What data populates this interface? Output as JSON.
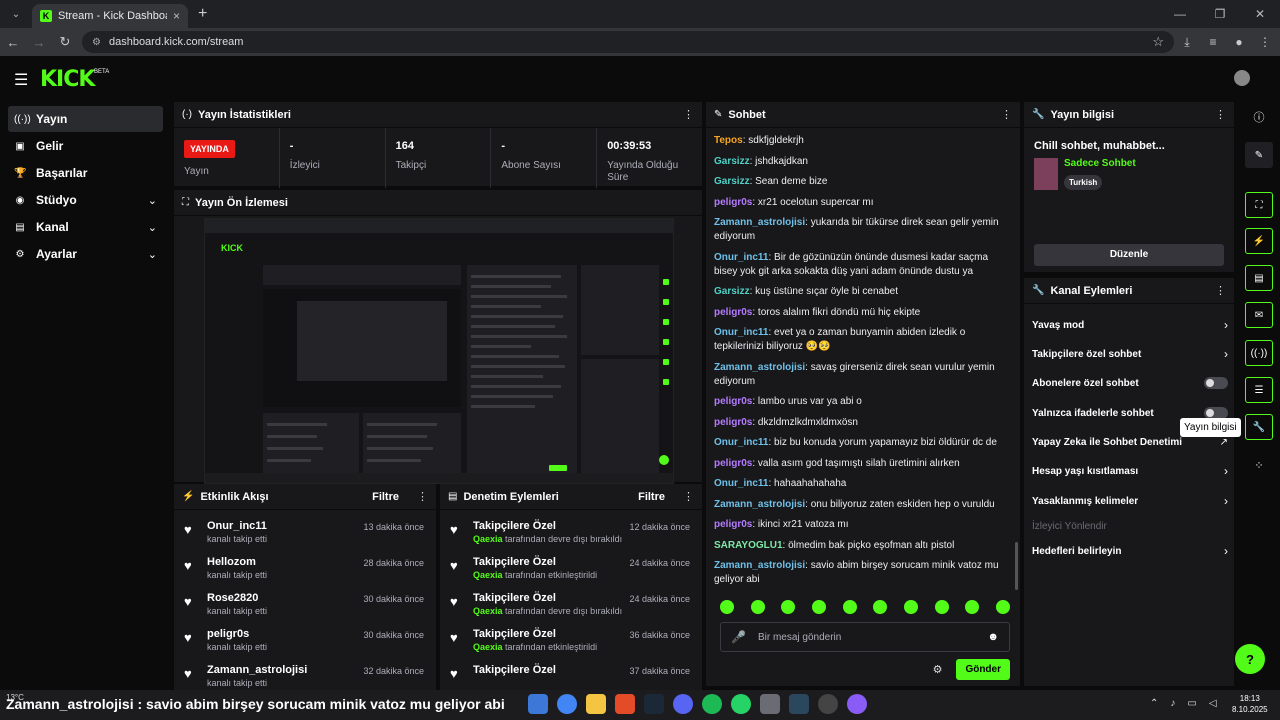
{
  "browser": {
    "tab_title": "Stream - Kick Dashboard",
    "url": "dashboard.kick.com/stream"
  },
  "brand": {
    "logo": "KICK",
    "beta": "BETA"
  },
  "sidebar": {
    "items": [
      {
        "label": "Yayın",
        "icon": "broadcast-icon"
      },
      {
        "label": "Gelir",
        "icon": "dollar-icon"
      },
      {
        "label": "Başarılar",
        "icon": "trophy-icon"
      },
      {
        "label": "Stüdyo",
        "icon": "studio-icon"
      },
      {
        "label": "Kanal",
        "icon": "channel-icon"
      },
      {
        "label": "Ayarlar",
        "icon": "gear-icon"
      }
    ]
  },
  "stats": {
    "title": "Yayın İstatistikleri",
    "live_badge": "YAYINDA",
    "live_label": "Yayın",
    "viewers_value": "-",
    "viewers_label": "İzleyici",
    "followers_value": "164",
    "followers_label": "Takipçi",
    "subs_value": "-",
    "subs_label": "Abone Sayısı",
    "uptime_value": "00:39:53",
    "uptime_label": "Yayında Olduğu Süre"
  },
  "preview": {
    "title": "Yayın Ön İzlemesi"
  },
  "activity": {
    "title": "Etkinlik Akışı",
    "filter": "Filtre",
    "items": [
      {
        "name": "Onur_inc11",
        "sub": "kanalı takip etti",
        "time": "13 dakika önce"
      },
      {
        "name": "Hellozom",
        "sub": "kanalı takip etti",
        "time": "28 dakika önce"
      },
      {
        "name": "Rose2820",
        "sub": "kanalı takip etti",
        "time": "30 dakika önce"
      },
      {
        "name": "peligr0s",
        "sub": "kanalı takip etti",
        "time": "30 dakika önce"
      },
      {
        "name": "Zamann_astrolojisi",
        "sub": "kanalı takip etti",
        "time": "32 dakika önce"
      }
    ]
  },
  "moderation": {
    "title": "Denetim Eylemleri",
    "filter": "Filtre",
    "items": [
      {
        "name": "Takipçilere Özel",
        "actor": "Qaexia",
        "sub": "tarafından devre dışı bırakıldı",
        "time": "12 dakika önce"
      },
      {
        "name": "Takipçilere Özel",
        "actor": "Qaexia",
        "sub": "tarafından etkinleştirildi",
        "time": "24 dakika önce"
      },
      {
        "name": "Takipçilere Özel",
        "actor": "Qaexia",
        "sub": "tarafından devre dışı bırakıldı",
        "time": "24 dakika önce"
      },
      {
        "name": "Takipçilere Özel",
        "actor": "Qaexia",
        "sub": "tarafından etkinleştirildi",
        "time": "36 dakika önce"
      },
      {
        "name": "Takipçilere Özel",
        "actor": "",
        "sub": "",
        "time": "37 dakika önce"
      }
    ]
  },
  "chat": {
    "title": "Sohbet",
    "messages": [
      {
        "user": "Tepos",
        "color": "#f5a623",
        "text": "sdkfjgldekrjh"
      },
      {
        "user": "Garsizz",
        "color": "#4fd1c5",
        "text": "jshdkajdkan"
      },
      {
        "user": "Garsizz",
        "color": "#4fd1c5",
        "text": "Sean deme bize"
      },
      {
        "user": "peligr0s",
        "color": "#b57bff",
        "text": "xr21 ocelotun supercar mı"
      },
      {
        "user": "Zamann_astrolojisi",
        "color": "#6fc0e8",
        "text": "yukarıda bir tükürse direk sean gelir yemin ediyorum"
      },
      {
        "user": "Onur_inc11",
        "color": "#6fc0e8",
        "text": "Bir de gözünüzün önünde dusmesi kadar saçma bisey yok git arka sokakta düş yani adam önünde dustu ya"
      },
      {
        "user": "Garsizz",
        "color": "#4fd1c5",
        "text": "kuş üstüne sıçar öyle bi cenabet"
      },
      {
        "user": "peligr0s",
        "color": "#b57bff",
        "text": "toros alalım fikri döndü mü hiç ekipte"
      },
      {
        "user": "Onur_inc11",
        "color": "#6fc0e8",
        "text": "evet ya o zaman bunyamin abiden izledik o tepkilerinizi biliyoruz 🥺🥺"
      },
      {
        "user": "Zamann_astrolojisi",
        "color": "#6fc0e8",
        "text": "savaş girerseniz direk sean vurulur yemin ediyorum"
      },
      {
        "user": "peligr0s",
        "color": "#b57bff",
        "text": "lambo urus var ya abi o"
      },
      {
        "user": "peligr0s",
        "color": "#b57bff",
        "text": "dkzldmzlkdmxldmxösn"
      },
      {
        "user": "Onur_inc11",
        "color": "#6fc0e8",
        "text": "biz bu konuda yorum yapamayız bizi öldürür dc de"
      },
      {
        "user": "peligr0s",
        "color": "#b57bff",
        "text": "valla asım god taşımıştı silah üretimini alırken"
      },
      {
        "user": "Onur_inc11",
        "color": "#6fc0e8",
        "text": "hahaahahahaha"
      },
      {
        "user": "Zamann_astrolojisi",
        "color": "#6fc0e8",
        "text": "onu biliyoruz zaten eskiden hep o vuruldu"
      },
      {
        "user": "peligr0s",
        "color": "#b57bff",
        "text": "ikinci xr21 vatoza mı"
      },
      {
        "user": "SARAYOGLU1",
        "color": "#7ee8a7",
        "text": "ölmedim bak piçko eşofman altı pistol"
      },
      {
        "user": "Zamann_astrolojisi",
        "color": "#6fc0e8",
        "text": "savio abim birşey sorucam minik vatoz mu geliyor abi"
      }
    ],
    "input_placeholder": "Bir mesaj gönderin",
    "send_label": "Gönder"
  },
  "stream_info": {
    "title": "Yayın bilgisi",
    "stream_title": "Chill sohbet, muhabbet...",
    "category": "Sadece Sohbet",
    "tag": "Turkish",
    "edit_label": "Düzenle"
  },
  "channel_actions": {
    "title": "Kanal Eylemleri",
    "items": [
      {
        "label": "Yavaş mod",
        "control": "chevron"
      },
      {
        "label": "Takipçilere özel sohbet",
        "control": "chevron"
      },
      {
        "label": "Abonelere özel sohbet",
        "control": "toggle"
      },
      {
        "label": "Yalnızca ifadelerle sohbet",
        "control": "toggle"
      },
      {
        "label": "Yapay Zeka ile Sohbet Denetimi",
        "control": "external"
      },
      {
        "label": "Hesap yaşı kısıtlaması",
        "control": "chevron"
      },
      {
        "label": "Yasaklanmış kelimeler",
        "control": "chevron"
      },
      {
        "label": "İzleyici Yönlendir",
        "control": "none"
      },
      {
        "label": "Hedefleri belirleyin",
        "control": "chevron"
      }
    ]
  },
  "tooltip": "Yayın bilgisi",
  "taskbar": {
    "weather": "13°C",
    "ticker": "Zamann_astrolojisi : savio abim birşey sorucam minik vatoz mu geliyor abi",
    "time": "18:13",
    "date": "8.10.2025"
  },
  "colors": {
    "accent": "#53fc18",
    "live": "#e91916",
    "panel": "#18181b",
    "bg": "#0b0b0c"
  }
}
